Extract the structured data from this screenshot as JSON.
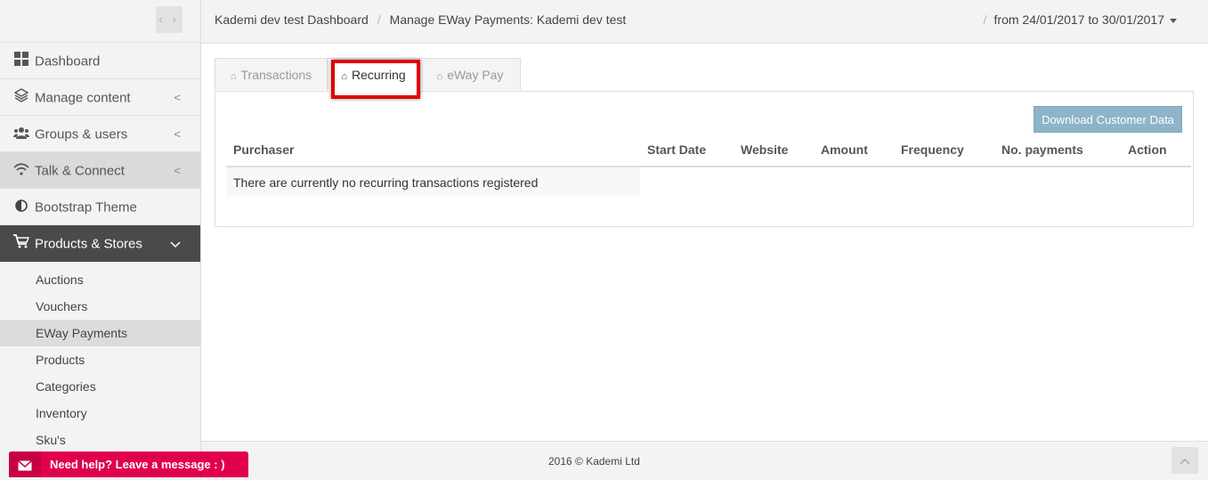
{
  "sidebar": {
    "toggle_glyph": "‹ ›",
    "items": [
      {
        "label": "Dashboard",
        "icon": "dashboard-icon"
      },
      {
        "label": "Manage content",
        "icon": "layers-icon"
      },
      {
        "label": "Groups & users",
        "icon": "users-icon"
      },
      {
        "label": "Talk & Connect",
        "icon": "wifi-icon"
      },
      {
        "label": "Bootstrap Theme",
        "icon": "contrast-icon"
      },
      {
        "label": "Products & Stores",
        "icon": "cart-icon"
      }
    ],
    "subitems": [
      "Auctions",
      "Vouchers",
      "EWay Payments",
      "Products",
      "Categories",
      "Inventory",
      "Sku's"
    ]
  },
  "header": {
    "breadcrumb": [
      "Kademi dev test Dashboard",
      "Manage EWay Payments: Kademi dev test"
    ],
    "daterange": "from 24/01/2017 to 30/01/2017"
  },
  "tabs": [
    {
      "label": "Transactions"
    },
    {
      "label": "Recurring"
    },
    {
      "label": "eWay Pay"
    }
  ],
  "panel": {
    "download_label": "Download Customer Data",
    "columns": [
      "Purchaser",
      "Start Date",
      "Website",
      "Amount",
      "Frequency",
      "No. payments",
      "Action"
    ],
    "empty_message": "There are currently no recurring transactions registered"
  },
  "footer": {
    "copyright": "2016 © Kademi Ltd",
    "help_label": "Need help? Leave a message : )"
  },
  "colors": {
    "active_nav": "#4a4a4a",
    "download_button": "#8db4c8",
    "highlight": "#e00000",
    "help_widget": "#e0004d"
  }
}
